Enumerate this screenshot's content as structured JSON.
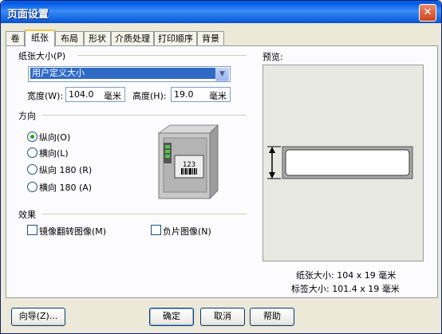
{
  "window": {
    "title": "页面设置",
    "close_glyph": "✕"
  },
  "tabs": [
    {
      "label": "卷"
    },
    {
      "label": "纸张"
    },
    {
      "label": "布局"
    },
    {
      "label": "形状"
    },
    {
      "label": "介质处理"
    },
    {
      "label": "打印顺序"
    },
    {
      "label": "背景"
    }
  ],
  "paper_size": {
    "group_label": "纸张大小(P)",
    "selected": "用户定义大小",
    "width_label": "宽度(W):",
    "width_value": "104.0",
    "width_unit": "毫米",
    "height_label": "高度(H):",
    "height_value": "19.0",
    "height_unit": "毫米"
  },
  "orientation": {
    "group_label": "方向",
    "options": [
      "纵向(O)",
      "横向(L)",
      "纵向 180 (R)",
      "横向 180 (A)"
    ],
    "selected_index": 0,
    "printer_label_text": "123"
  },
  "effects": {
    "group_label": "效果",
    "mirror_label": "镜像翻转图像(M)",
    "mirror_checked": false,
    "negative_label": "负片图像(N)",
    "negative_checked": false
  },
  "preview": {
    "label": "预览:",
    "paper_size_text": "纸张大小: 104 x 19 毫米",
    "label_size_text": "标签大小: 101.4 x 19 毫米"
  },
  "buttons": {
    "wizard": "向导(Z)...",
    "ok": "确定",
    "cancel": "取消",
    "help": "帮助"
  },
  "colors": {
    "title_bar": "#0058e6",
    "selection": "#316ac5",
    "active_tab_accent": "#ffc73c",
    "radio_dot": "#21a121"
  }
}
